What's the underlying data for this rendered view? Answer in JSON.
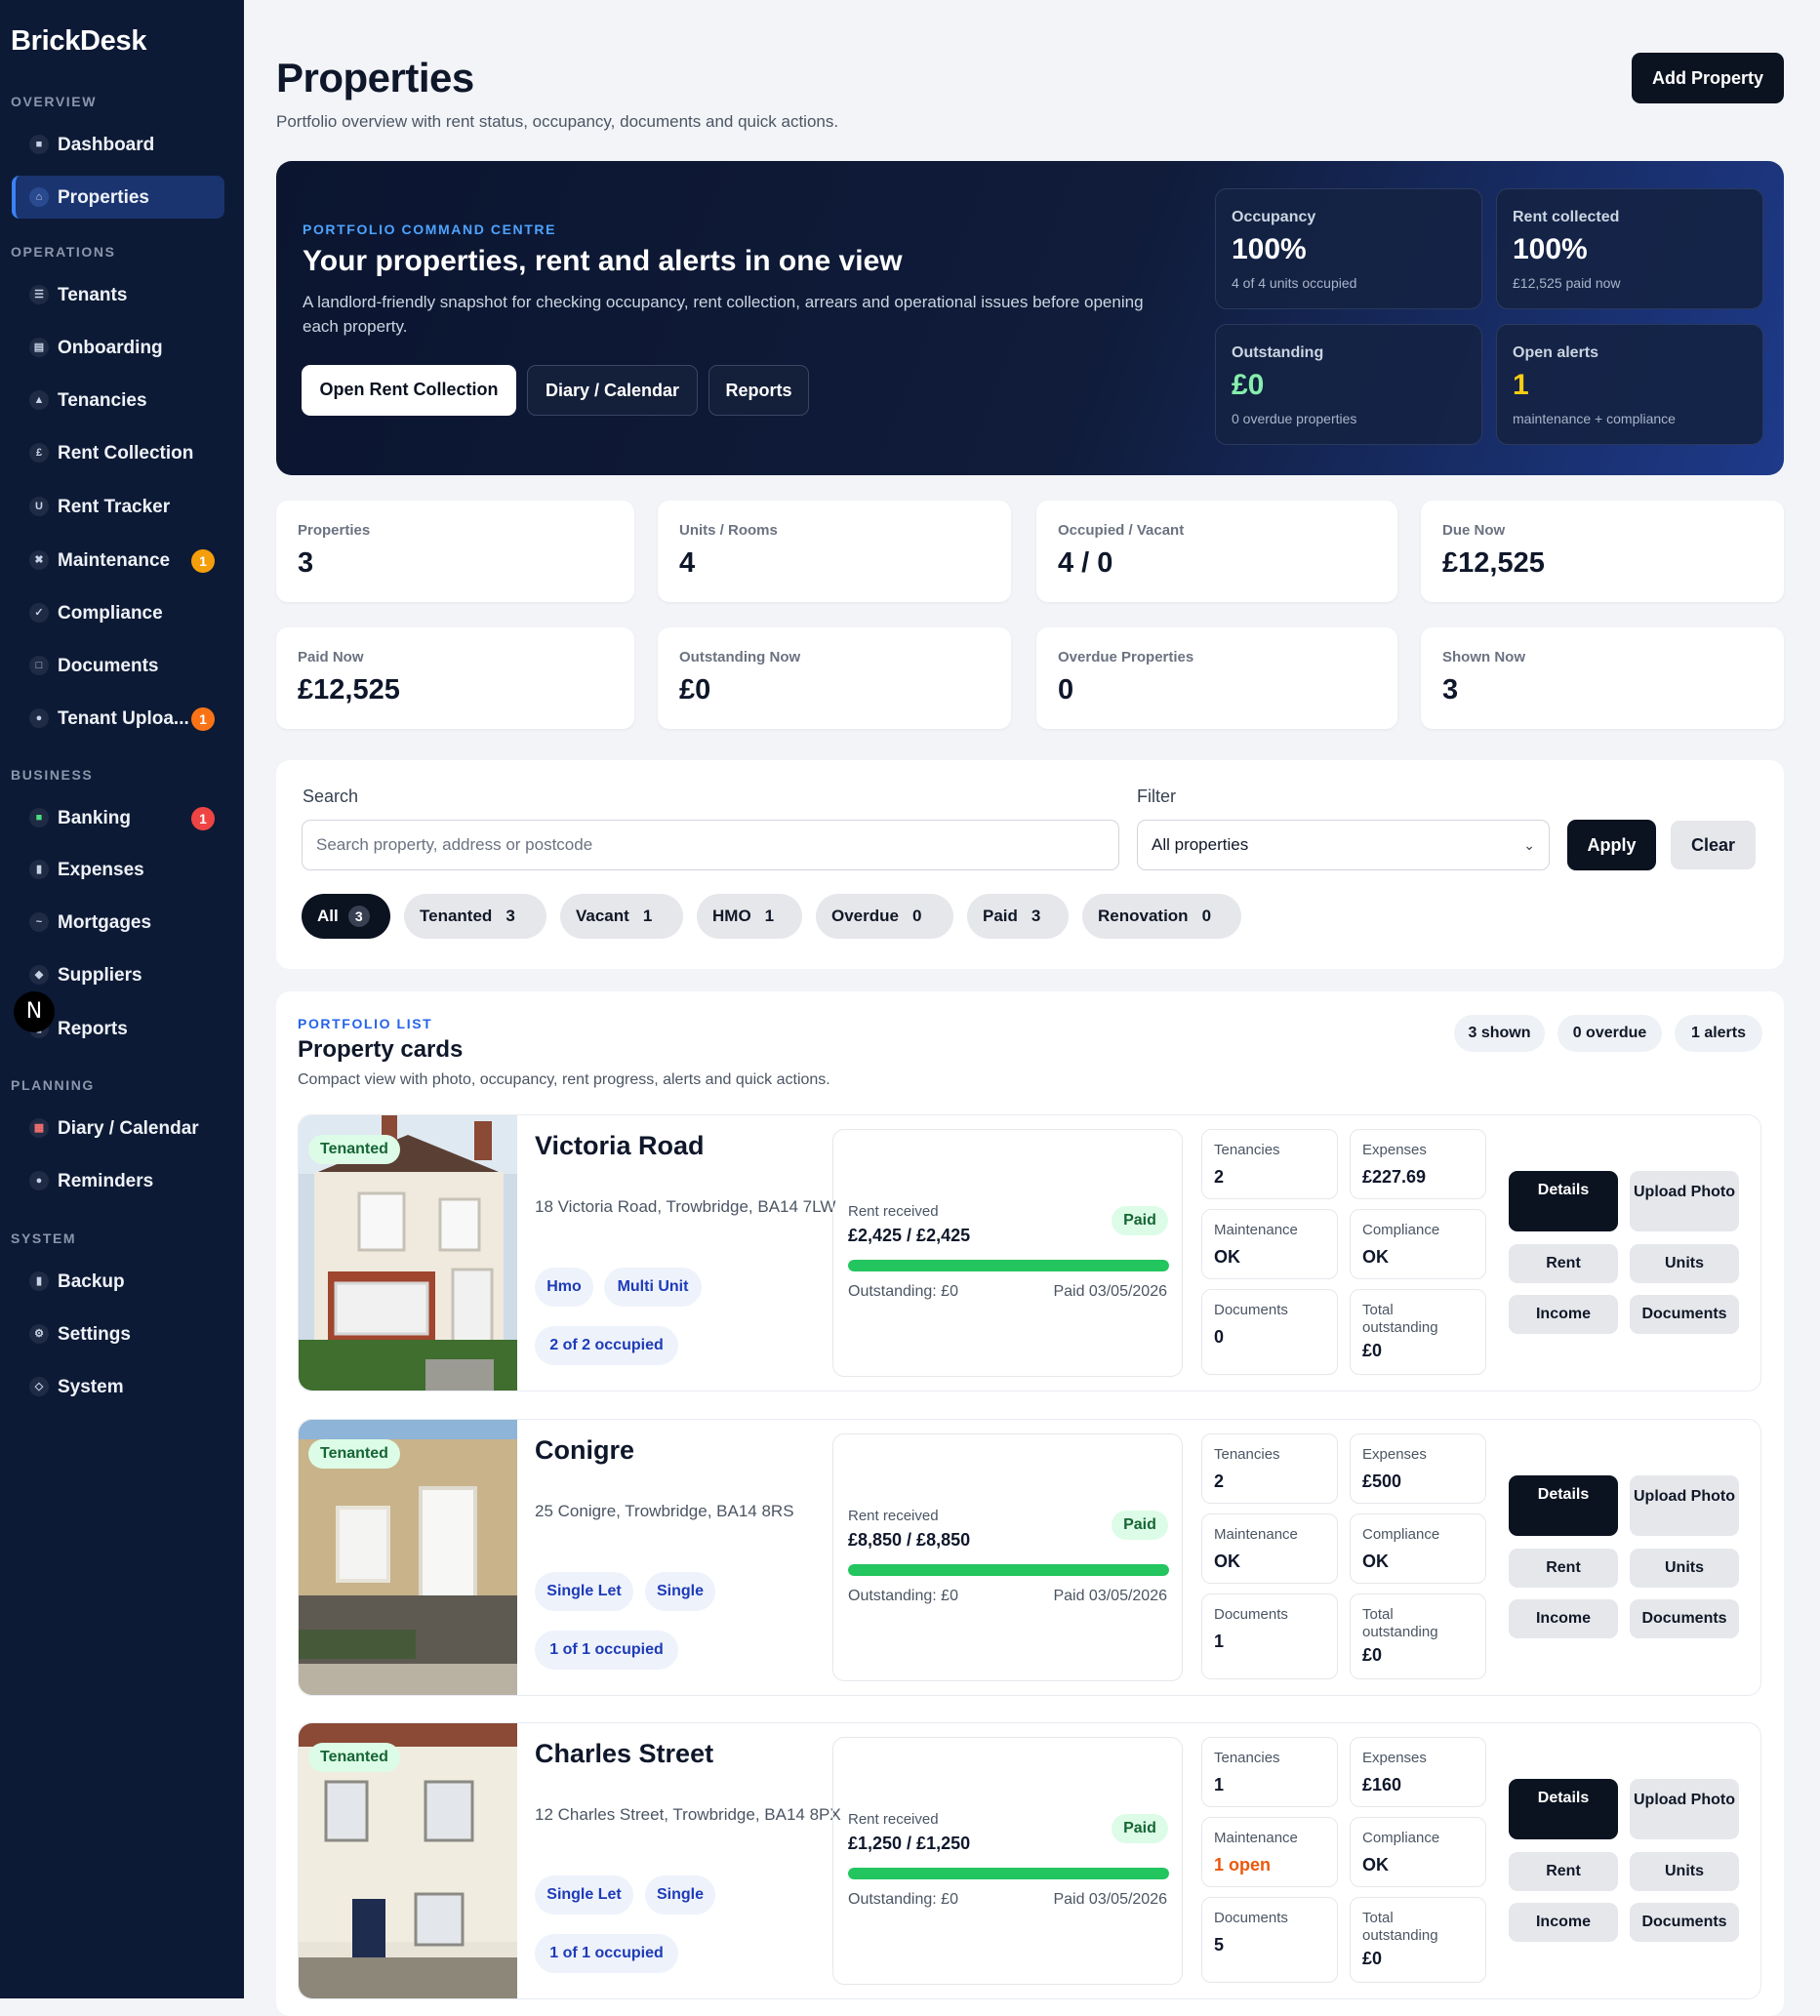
{
  "brand": "BrickDesk",
  "sidebar": {
    "sections": {
      "overview": "OVERVIEW",
      "operations": "OPERATIONS",
      "business": "BUSINESS",
      "planning": "PLANNING",
      "system": "SYSTEM"
    },
    "items": [
      {
        "label": "Dashboard",
        "icon": "grid-icon",
        "glyph": "■"
      },
      {
        "label": "Properties",
        "icon": "home-icon",
        "glyph": "⌂"
      },
      {
        "label": "Tenants",
        "icon": "users-icon",
        "glyph": "☰"
      },
      {
        "label": "Onboarding",
        "icon": "clipboard-icon",
        "glyph": "▤"
      },
      {
        "label": "Tenancies",
        "icon": "key-icon",
        "glyph": "▲"
      },
      {
        "label": "Rent Collection",
        "icon": "pound-icon",
        "glyph": "£"
      },
      {
        "label": "Rent Tracker",
        "icon": "tracker-icon",
        "glyph": "U"
      },
      {
        "label": "Maintenance",
        "icon": "wrench-icon",
        "glyph": "✖",
        "badge": "1"
      },
      {
        "label": "Compliance",
        "icon": "check-icon",
        "glyph": "✓"
      },
      {
        "label": "Documents",
        "icon": "document-icon",
        "glyph": "□"
      },
      {
        "label": "Tenant Uploa...",
        "icon": "upload-icon",
        "glyph": "●",
        "badge": "1"
      },
      {
        "label": "Banking",
        "icon": "bank-icon",
        "glyph": "■",
        "badge": "1"
      },
      {
        "label": "Expenses",
        "icon": "receipt-icon",
        "glyph": "▮"
      },
      {
        "label": "Mortgages",
        "icon": "mortgage-icon",
        "glyph": "~"
      },
      {
        "label": "Suppliers",
        "icon": "supplier-icon",
        "glyph": "◆"
      },
      {
        "label": "Reports",
        "icon": "reports-icon",
        "glyph": "▮"
      },
      {
        "label": "Diary / Calendar",
        "icon": "calendar-icon",
        "glyph": "▦"
      },
      {
        "label": "Reminders",
        "icon": "bell-icon",
        "glyph": "●"
      },
      {
        "label": "Backup",
        "icon": "backup-icon",
        "glyph": "▮"
      },
      {
        "label": "Settings",
        "icon": "gear-icon",
        "glyph": "⚙"
      },
      {
        "label": "System",
        "icon": "system-icon",
        "glyph": "◇"
      }
    ],
    "avatar_letter": "N"
  },
  "page": {
    "title": "Properties",
    "subtitle": "Portfolio overview with rent status, occupancy, documents and quick actions.",
    "add_button": "Add Property"
  },
  "hero": {
    "kicker": "PORTFOLIO COMMAND CENTRE",
    "title": "Your properties, rent and alerts in one view",
    "description": "A landlord-friendly snapshot for checking occupancy, rent collection, arrears and operational issues before opening each property.",
    "buttons": [
      "Open Rent Collection",
      "Diary / Calendar",
      "Reports"
    ],
    "stats": [
      {
        "label": "Occupancy",
        "value": "100%",
        "sub": "4 of 4 units occupied",
        "color": "#ffffff"
      },
      {
        "label": "Rent collected",
        "value": "100%",
        "sub": "£12,525 paid now",
        "color": "#ffffff"
      },
      {
        "label": "Outstanding",
        "value": "£0",
        "sub": "0 overdue properties",
        "color": "#86efac"
      },
      {
        "label": "Open alerts",
        "value": "1",
        "sub": "maintenance + compliance",
        "color": "#facc15"
      }
    ]
  },
  "stats": [
    {
      "label": "Properties",
      "value": "3"
    },
    {
      "label": "Units / Rooms",
      "value": "4"
    },
    {
      "label": "Occupied / Vacant",
      "value": "4 / 0"
    },
    {
      "label": "Due Now",
      "value": "£12,525"
    },
    {
      "label": "Paid Now",
      "value": "£12,525"
    },
    {
      "label": "Outstanding Now",
      "value": "£0"
    },
    {
      "label": "Overdue Properties",
      "value": "0"
    },
    {
      "label": "Shown Now",
      "value": "3"
    }
  ],
  "search": {
    "label": "Search",
    "placeholder": "Search property, address or postcode",
    "filter_label": "Filter",
    "filter_value": "All properties",
    "apply": "Apply",
    "clear": "Clear",
    "chips": [
      {
        "label": "All",
        "count": "3"
      },
      {
        "label": "Tenanted",
        "count": "3"
      },
      {
        "label": "Vacant",
        "count": "1"
      },
      {
        "label": "HMO",
        "count": "1"
      },
      {
        "label": "Overdue",
        "count": "0"
      },
      {
        "label": "Paid",
        "count": "3"
      },
      {
        "label": "Renovation",
        "count": "0"
      }
    ]
  },
  "portfolio": {
    "kicker": "PORTFOLIO LIST",
    "title": "Property cards",
    "subtitle": "Compact view with photo, occupancy, rent progress, alerts and quick actions.",
    "pills": [
      "3 shown",
      "0 overdue",
      "1 alerts"
    ],
    "labels": {
      "rent_received": "Rent received",
      "paid": "Paid",
      "tenancies": "Tenancies",
      "expenses": "Expenses",
      "maintenance": "Maintenance",
      "compliance": "Compliance",
      "documents": "Documents",
      "total_outstanding": "Total outstanding"
    },
    "actions": [
      "Details",
      "Upload Photo",
      "Rent",
      "Units",
      "Income",
      "Documents"
    ],
    "cards": [
      {
        "status": "Tenanted",
        "name": "Victoria Road",
        "address": "18 Victoria Road, Trowbridge, BA14 7LW",
        "tags": [
          "Hmo",
          "Multi Unit"
        ],
        "occupied": "2 of 2 occupied",
        "rent": "£2,425 / £2,425",
        "rent_fraction": 1.0,
        "outstanding": "Outstanding: £0",
        "paid_date": "Paid 03/05/2026",
        "tenancies": "2",
        "expenses": "£227.69",
        "maintenance": "OK",
        "maintenance_warn": false,
        "compliance": "OK",
        "documents": "0",
        "total_outstanding": "£0"
      },
      {
        "status": "Tenanted",
        "name": "Conigre",
        "address": "25 Conigre, Trowbridge, BA14 8RS",
        "tags": [
          "Single Let",
          "Single"
        ],
        "occupied": "1 of 1 occupied",
        "rent": "£8,850 / £8,850",
        "rent_fraction": 1.0,
        "outstanding": "Outstanding: £0",
        "paid_date": "Paid 03/05/2026",
        "tenancies": "2",
        "expenses": "£500",
        "maintenance": "OK",
        "maintenance_warn": false,
        "compliance": "OK",
        "documents": "1",
        "total_outstanding": "£0"
      },
      {
        "status": "Tenanted",
        "name": "Charles Street",
        "address": "12 Charles Street, Trowbridge, BA14 8PX",
        "tags": [
          "Single Let",
          "Single"
        ],
        "occupied": "1 of 1 occupied",
        "rent": "£1,250 / £1,250",
        "rent_fraction": 1.0,
        "outstanding": "Outstanding: £0",
        "paid_date": "Paid 03/05/2026",
        "tenancies": "1",
        "expenses": "£160",
        "maintenance": "1 open",
        "maintenance_warn": true,
        "compliance": "OK",
        "documents": "5",
        "total_outstanding": "£0"
      }
    ]
  }
}
